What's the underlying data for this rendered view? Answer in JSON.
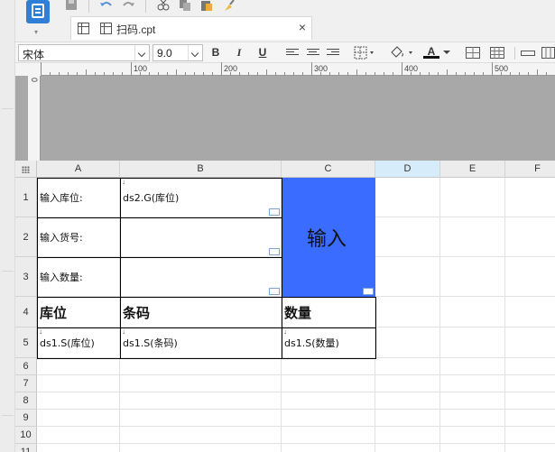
{
  "toolbar": {
    "top_icons": [
      "save-icon",
      "undo-icon",
      "redo-icon",
      "cut-icon",
      "copy-icon",
      "paste-icon",
      "format-brush-icon"
    ]
  },
  "tab": {
    "title": "扫码.cpt"
  },
  "format": {
    "font_name": "宋体",
    "font_size": "9.0",
    "bold_label": "B",
    "italic_label": "I",
    "underline_label": "U",
    "font_color_label": "A"
  },
  "ruler": {
    "marks": [
      "100",
      "200",
      "300",
      "400",
      "500"
    ],
    "vertical_mark": "0"
  },
  "grid": {
    "columns": [
      "A",
      "B",
      "C",
      "D",
      "E",
      "F"
    ],
    "selected_column": "D",
    "rows": [
      "1",
      "2",
      "3",
      "4",
      "5",
      "6",
      "7",
      "8",
      "9",
      "10",
      "11"
    ],
    "cells": {
      "A1": "输入库位:",
      "B1": "ds2.G(库位)",
      "A2": "输入货号:",
      "A3": "输入数量:",
      "C1": "输入",
      "A4": "库位",
      "B4": "条码",
      "C4": "数量",
      "A5": "ds1.S(库位)",
      "B5": "ds1.S(条码)",
      "C5": "ds1.S(数量)"
    },
    "accent_color": "#3a6cff",
    "selected_header_color": "#d7ecfb"
  }
}
